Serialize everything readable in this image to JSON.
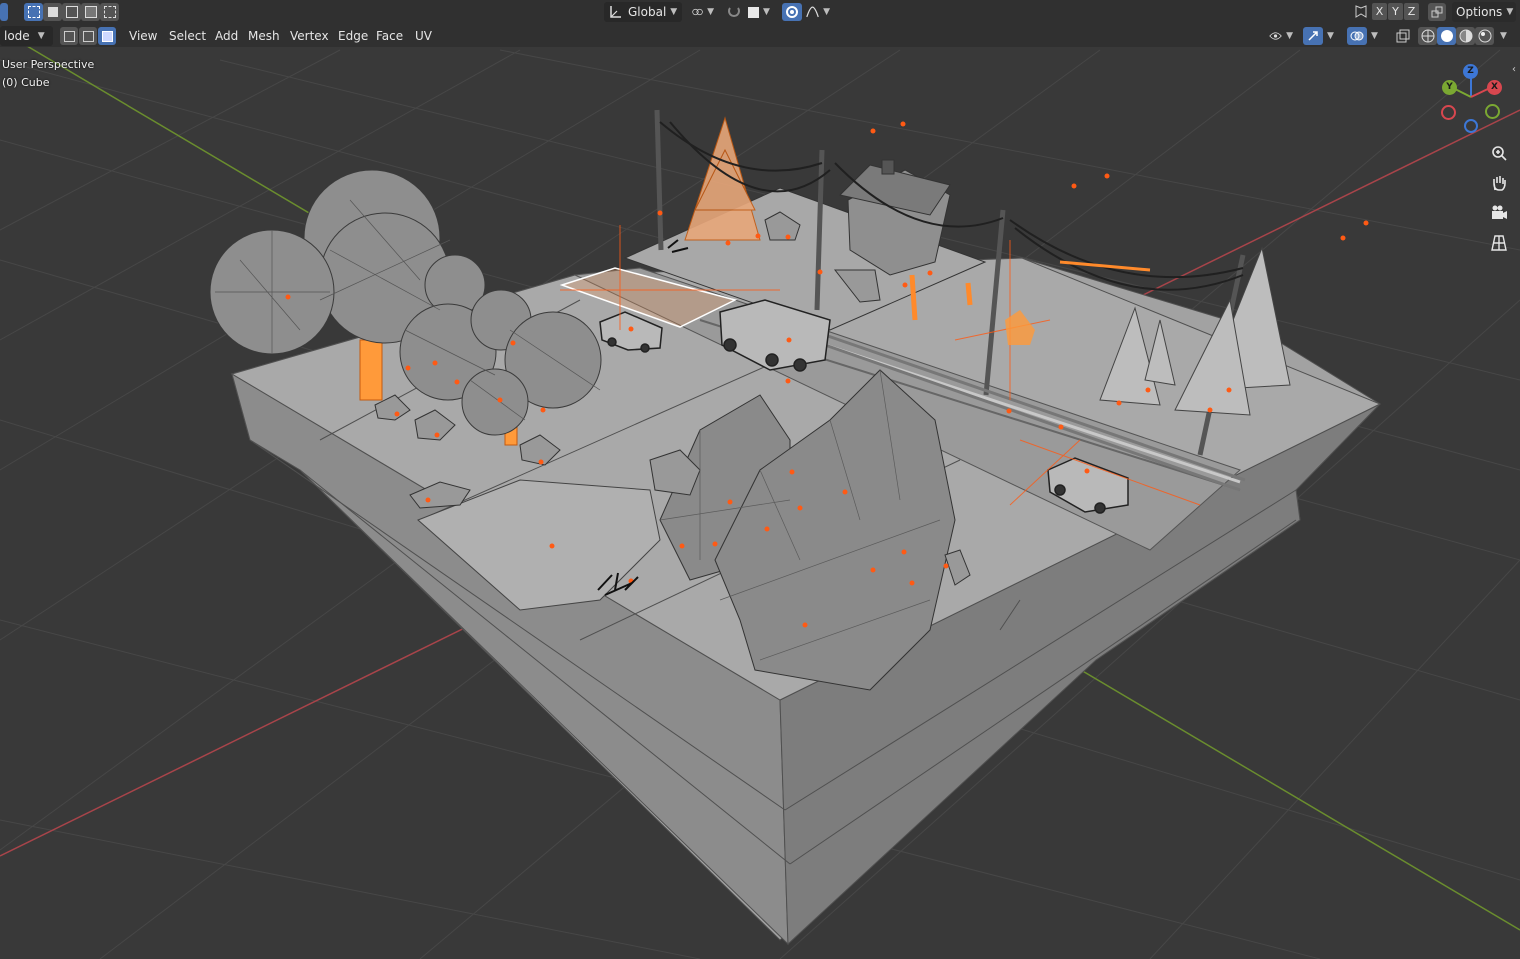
{
  "header": {
    "mode_label": "lode",
    "menus": [
      "View",
      "Select",
      "Add",
      "Mesh",
      "Vertex",
      "Edge",
      "Face",
      "UV"
    ],
    "transform_orientation": "Global",
    "mirror_axes": [
      "X",
      "Y",
      "Z"
    ],
    "options_label": "Options"
  },
  "viewport": {
    "view_name": "User Perspective",
    "object_info": "(0) Cube"
  },
  "gizmo": {
    "labels": [
      "Z",
      "Y",
      "X"
    ]
  },
  "colors": {
    "background": "#393939",
    "grid": "#4a4a4a",
    "x_axis": "#b0464a",
    "y_axis": "#6b8f2f",
    "selection": "#ff8a2b",
    "vertex_dot": "#ff5a14",
    "mesh_face": "#9d9d9d",
    "active_button": "#4772b3"
  },
  "icons": [
    "select-box-icon",
    "orientation-icon",
    "snap-icon",
    "proportional-edit-icon",
    "falloff-icon",
    "visibility-icon",
    "gizmo-icon",
    "overlay-icon",
    "xray-icon",
    "wireframe-shading-icon",
    "solid-shading-icon",
    "material-shading-icon",
    "rendered-shading-icon",
    "zoom-icon",
    "hand-icon",
    "camera-icon",
    "grid-icon"
  ]
}
